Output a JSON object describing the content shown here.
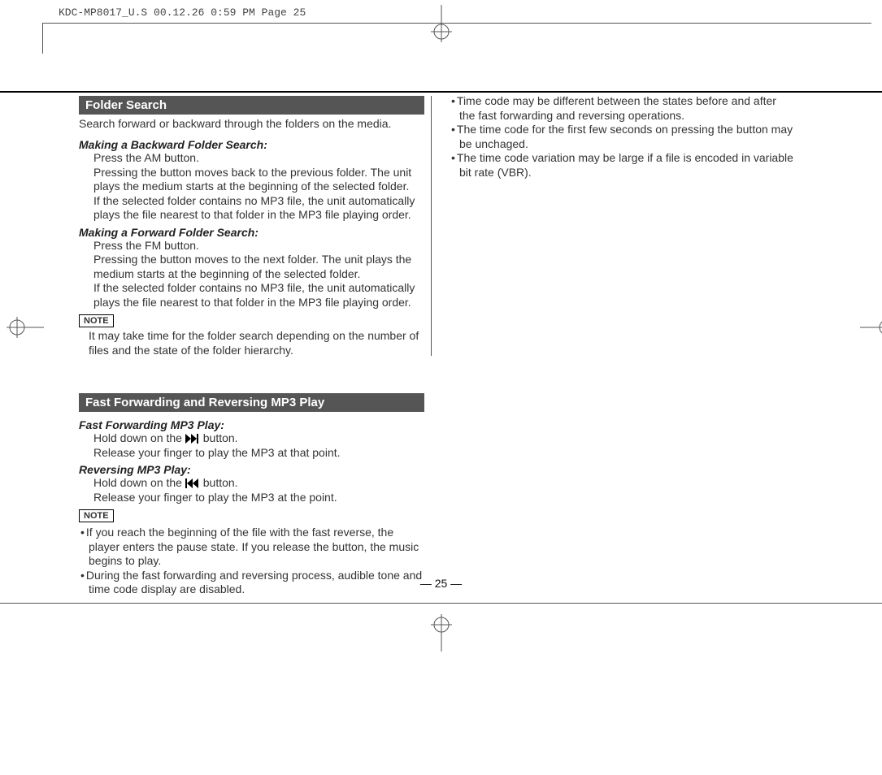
{
  "header": "KDC-MP8017_U.S  00.12.26 0:59 PM  Page 25",
  "page_number": "— 25 —",
  "section1": {
    "title": "Folder Search",
    "intro": "Search forward or backward through the folders on the media.",
    "sub_a": {
      "heading": "Making a Backward Folder Search:",
      "l1": "Press the AM button.",
      "l2": "Pressing the button moves back to the previous folder. The unit plays the medium starts at the beginning of the selected folder.",
      "l3": "If the selected folder contains no MP3 file, the unit automatically plays the file nearest to that folder in the MP3 file playing order."
    },
    "sub_b": {
      "heading": "Making a Forward Folder Search:",
      "l1": "Press the FM button.",
      "l2": "Pressing the button moves to the next folder. The unit plays the medium starts at the beginning of the selected folder.",
      "l3": "If the selected folder contains no MP3 file, the unit automatically plays the file nearest to that folder in the MP3 file playing order."
    },
    "note_label": "NOTE",
    "note_text": "It may take time for the folder search depending on the number of files and the state of the folder hierarchy."
  },
  "section2": {
    "title": "Fast Forwarding and Reversing MP3 Play",
    "sub_a": {
      "heading": "Fast Forwarding MP3 Play:",
      "l1a": "Hold down on the ",
      "l1b": " button.",
      "l2": "Release your finger to play the MP3 at that point."
    },
    "sub_b": {
      "heading": "Reversing MP3 Play:",
      "l1a": "Hold down on the ",
      "l1b": " button.",
      "l2": "Release your finger to play the MP3 at the point."
    },
    "note_label": "NOTE",
    "bullets_left": [
      "If you reach the beginning of the file with the fast reverse, the player enters the pause state. If you release the button, the music begins to play.",
      "During the fast forwarding and reversing process, audible tone and time code display are disabled."
    ]
  },
  "right_col_bullets": [
    "Time code may be different between the states before and after the fast forwarding and reversing operations.",
    "The time code for the first few seconds on pressing the button may be unchaged.",
    "The time code variation may be large if a file is encoded in variable bit rate (VBR)."
  ]
}
